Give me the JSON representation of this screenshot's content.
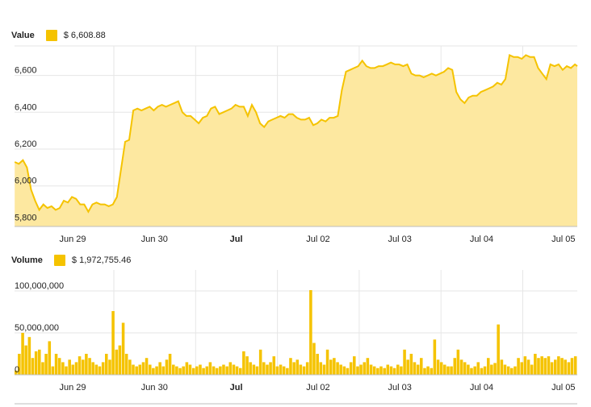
{
  "legend": {
    "value_label": "Value",
    "value_amount": "$  6,608.88",
    "volume_label": "Volume",
    "volume_amount": "$  1,972,755.46"
  },
  "colors": {
    "accent": "#f5c300",
    "area": "#fde8a0",
    "grid": "#e6e6e6",
    "axis": "#bdbdbd"
  },
  "chart_data": [
    {
      "type": "area",
      "series_name": "Value",
      "x_ticks": [
        "Jun 29",
        "Jun 30",
        "Jul",
        "Jul 02",
        "Jul 03",
        "Jul 04",
        "Jul 05"
      ],
      "bold_ticks": [
        "Jul"
      ],
      "y_ticks": [
        5800,
        6000,
        6200,
        6400,
        6600
      ],
      "y_tick_labels": [
        "5,800",
        "6,000",
        "6,200",
        "6,400",
        "6,600"
      ],
      "ylim": [
        5780,
        6760
      ],
      "x_range_days": [
        -0.6,
        6.3
      ],
      "x": [
        -0.6,
        -0.55,
        -0.5,
        -0.45,
        -0.4,
        -0.35,
        -0.3,
        -0.25,
        -0.2,
        -0.15,
        -0.1,
        -0.05,
        0.0,
        0.05,
        0.1,
        0.15,
        0.2,
        0.25,
        0.3,
        0.35,
        0.4,
        0.45,
        0.5,
        0.55,
        0.6,
        0.65,
        0.7,
        0.75,
        0.8,
        0.85,
        0.9,
        0.95,
        1.0,
        1.05,
        1.1,
        1.15,
        1.2,
        1.25,
        1.3,
        1.35,
        1.4,
        1.45,
        1.5,
        1.55,
        1.6,
        1.65,
        1.7,
        1.75,
        1.8,
        1.85,
        1.9,
        1.95,
        2.0,
        2.05,
        2.1,
        2.15,
        2.2,
        2.25,
        2.3,
        2.35,
        2.4,
        2.45,
        2.5,
        2.55,
        2.6,
        2.65,
        2.7,
        2.75,
        2.8,
        2.85,
        2.9,
        2.95,
        3.0,
        3.05,
        3.1,
        3.15,
        3.2,
        3.25,
        3.3,
        3.35,
        3.4,
        3.45,
        3.5,
        3.55,
        3.6,
        3.65,
        3.7,
        3.75,
        3.8,
        3.85,
        3.9,
        3.95,
        4.0,
        4.05,
        4.1,
        4.15,
        4.2,
        4.25,
        4.3,
        4.35,
        4.4,
        4.45,
        4.5,
        4.55,
        4.6,
        4.65,
        4.7,
        4.75,
        4.8,
        4.85,
        4.9,
        4.95,
        5.0,
        5.05,
        5.1,
        5.15,
        5.2,
        5.25,
        5.3,
        5.35,
        5.4,
        5.45,
        5.5,
        5.55,
        5.6,
        5.65,
        5.7,
        5.75,
        5.8,
        5.85,
        5.9,
        5.95,
        6.0,
        6.05,
        6.1,
        6.15,
        6.2,
        6.25,
        6.3
      ],
      "values": [
        6130,
        6120,
        6140,
        6100,
        5980,
        5920,
        5870,
        5900,
        5880,
        5890,
        5870,
        5880,
        5920,
        5910,
        5940,
        5930,
        5900,
        5900,
        5860,
        5900,
        5910,
        5900,
        5900,
        5890,
        5900,
        5940,
        6090,
        6240,
        6250,
        6410,
        6420,
        6410,
        6420,
        6430,
        6410,
        6430,
        6440,
        6430,
        6440,
        6450,
        6460,
        6400,
        6380,
        6380,
        6360,
        6340,
        6370,
        6380,
        6420,
        6430,
        6390,
        6400,
        6410,
        6420,
        6440,
        6430,
        6430,
        6380,
        6440,
        6400,
        6340,
        6320,
        6350,
        6360,
        6370,
        6380,
        6370,
        6390,
        6390,
        6370,
        6360,
        6360,
        6370,
        6330,
        6340,
        6360,
        6350,
        6370,
        6370,
        6380,
        6520,
        6620,
        6630,
        6640,
        6650,
        6680,
        6650,
        6640,
        6640,
        6650,
        6650,
        6660,
        6670,
        6660,
        6660,
        6650,
        6660,
        6610,
        6600,
        6600,
        6590,
        6600,
        6610,
        6600,
        6610,
        6620,
        6640,
        6630,
        6510,
        6470,
        6450,
        6480,
        6490,
        6490,
        6510,
        6520,
        6530,
        6540,
        6560,
        6550,
        6580,
        6710,
        6700,
        6700,
        6690,
        6710,
        6700,
        6700,
        6640,
        6610,
        6580,
        6660,
        6650,
        6660,
        6630,
        6650,
        6640,
        6660,
        6650,
        6610
      ]
    },
    {
      "type": "bar",
      "series_name": "Volume",
      "x_ticks": [
        "Jun 29",
        "Jun 30",
        "Jul",
        "Jul 02",
        "Jul 03",
        "Jul 04",
        "Jul 05"
      ],
      "bold_ticks": [
        "Jul"
      ],
      "y_ticks": [
        0,
        50000000,
        100000000
      ],
      "y_tick_labels": [
        "0",
        "50,000,000",
        "100,000,000"
      ],
      "ylim": [
        0,
        125000000
      ],
      "bar_start_day": -0.6,
      "bar_step_day": 0.05,
      "values": [
        5,
        25,
        50,
        35,
        45,
        20,
        28,
        30,
        15,
        25,
        40,
        10,
        25,
        20,
        15,
        10,
        18,
        12,
        15,
        22,
        18,
        25,
        20,
        15,
        12,
        10,
        15,
        25,
        18,
        76,
        30,
        35,
        62,
        25,
        18,
        12,
        10,
        12,
        15,
        20,
        12,
        8,
        10,
        15,
        10,
        18,
        25,
        12,
        10,
        8,
        10,
        15,
        12,
        8,
        10,
        12,
        8,
        10,
        15,
        10,
        8,
        10,
        12,
        10,
        15,
        12,
        10,
        8,
        28,
        22,
        15,
        12,
        10,
        30,
        15,
        12,
        15,
        22,
        10,
        12,
        10,
        8,
        20,
        15,
        18,
        12,
        10,
        15,
        101,
        38,
        25,
        15,
        12,
        30,
        18,
        20,
        15,
        12,
        10,
        8,
        15,
        22,
        10,
        12,
        15,
        20,
        12,
        10,
        8,
        10,
        8,
        12,
        10,
        8,
        12,
        10,
        30,
        18,
        25,
        15,
        12,
        20,
        8,
        10,
        8,
        42,
        18,
        15,
        12,
        10,
        10,
        20,
        30,
        18,
        15,
        12,
        8,
        10,
        15,
        8,
        10,
        20,
        12,
        14,
        60,
        18,
        12,
        10,
        8,
        10,
        20,
        15,
        22,
        18,
        12,
        25,
        20,
        22,
        20,
        22,
        15,
        18,
        22,
        20,
        18,
        15,
        20,
        22
      ]
    }
  ]
}
